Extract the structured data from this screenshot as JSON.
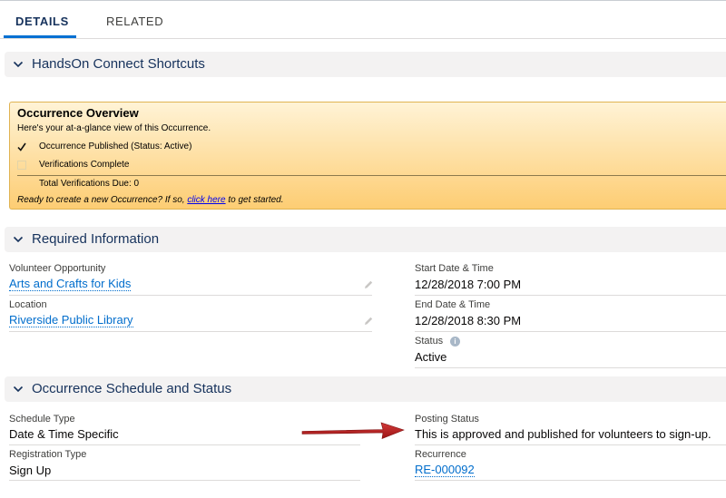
{
  "tabs": [
    {
      "label": "DETAILS"
    },
    {
      "label": "RELATED"
    }
  ],
  "sections": {
    "shortcuts": {
      "title": "HandsOn Connect Shortcuts"
    },
    "required": {
      "title": "Required Information"
    },
    "schedule": {
      "title": "Occurrence Schedule and Status"
    }
  },
  "overview": {
    "title": "Occurrence Overview",
    "subtitle": "Here's your at-a-glance view of this Occurrence.",
    "published_label": "Occurrence Published (Status: Active)",
    "verifications_label": "Verifications Complete",
    "total_due": "Total Verifications Due: 0",
    "ready_prefix": "Ready to create a new Occurrence? If so,",
    "ready_link": "click here",
    "ready_suffix": "to get started."
  },
  "required_info": {
    "volunteer_opportunity": {
      "label": "Volunteer Opportunity",
      "value": "Arts and Crafts for Kids"
    },
    "location": {
      "label": "Location",
      "value": "Riverside Public Library"
    },
    "start": {
      "label": "Start Date & Time",
      "value": "12/28/2018 7:00 PM"
    },
    "end": {
      "label": "End Date & Time",
      "value": "12/28/2018 8:30 PM"
    },
    "status": {
      "label": "Status",
      "value": "Active"
    }
  },
  "schedule_info": {
    "schedule_type": {
      "label": "Schedule Type",
      "value": "Date & Time Specific"
    },
    "registration_type": {
      "label": "Registration Type",
      "value": "Sign Up"
    },
    "posting_status": {
      "label": "Posting Status",
      "value": "This is approved and published for volunteers to sign-up."
    },
    "recurrence": {
      "label": "Recurrence",
      "value": "RE-000092"
    }
  },
  "colors": {
    "accent": "#0070d2",
    "link": "#006dcc",
    "overview_bg": "#fdcd73",
    "arrow": "#b01e1e"
  },
  "icons": [
    "chevron-down-icon",
    "checkmark-icon",
    "checkbox-icon",
    "pencil-icon",
    "info-icon",
    "arrow-icon"
  ]
}
